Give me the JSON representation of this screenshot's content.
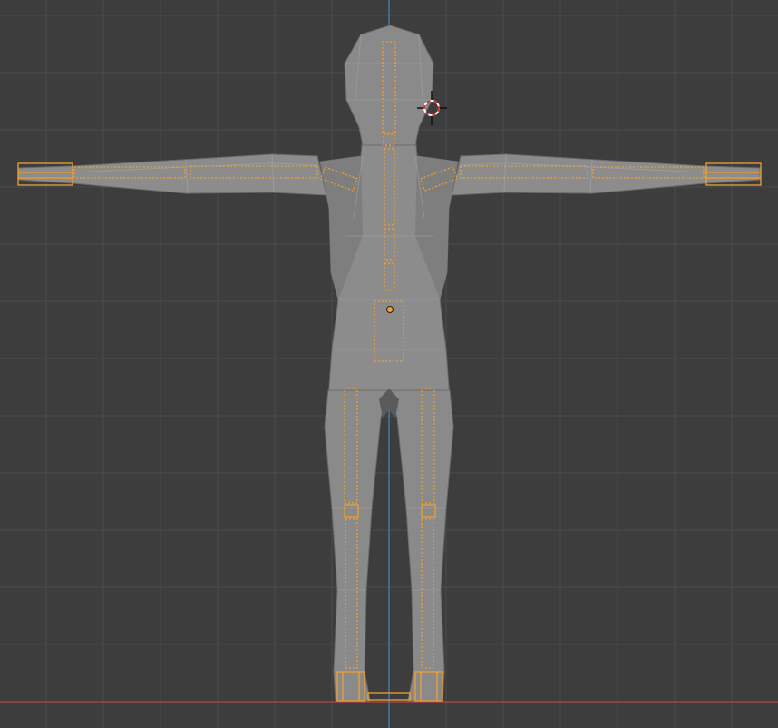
{
  "viewport": {
    "background_color": "#3d3d3d",
    "grid_color": "#4a4a4a",
    "x_axis_color": "#b4444f",
    "z_axis_color": "#4a86b8",
    "view": "front-orthographic",
    "shading": "solid"
  },
  "model": {
    "pose": "T-pose",
    "type": "low-poly humanoid mesh",
    "mesh_color": "#8a8a8a",
    "mesh_shadow_color": "#6e6e6e"
  },
  "armature": {
    "display": "B-Bone",
    "bone_outline_color": "#f0a030",
    "bones": [
      "head",
      "neck",
      "spine-upper",
      "spine-mid",
      "spine-lower",
      "hips",
      "shoulder-left",
      "upper-arm-left",
      "forearm-left",
      "hand-left",
      "shoulder-right",
      "upper-arm-right",
      "forearm-right",
      "hand-right",
      "thigh-left",
      "shin-left",
      "foot-left",
      "thigh-right",
      "shin-right",
      "foot-right",
      "heel-bar"
    ]
  },
  "cursor_3d": {
    "icon": "3d-cursor-icon",
    "ring_colors": [
      "#ffffff",
      "#d03030"
    ]
  },
  "origin": {
    "icon": "object-origin-icon",
    "color": "#f0a030"
  }
}
